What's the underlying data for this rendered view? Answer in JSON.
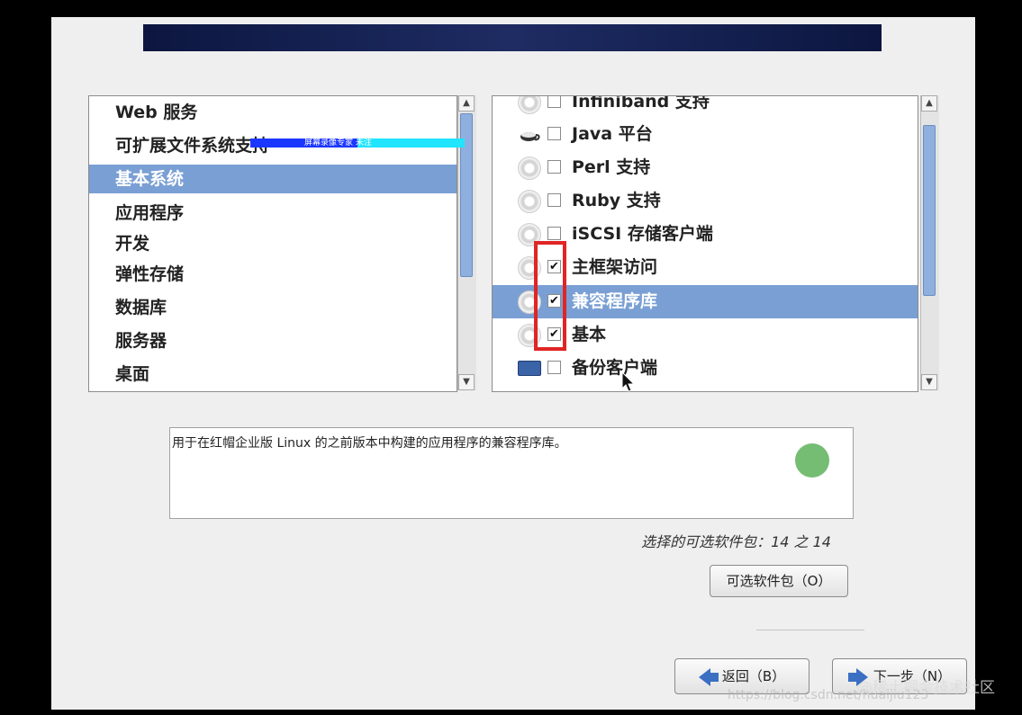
{
  "categories": [
    {
      "label": "Web 服务",
      "selected": false
    },
    {
      "label": "可扩展文件系统支持",
      "selected": false
    },
    {
      "label": "基本系统",
      "selected": true
    },
    {
      "label": "应用程序",
      "selected": false
    },
    {
      "label": "开发",
      "selected": false
    },
    {
      "label": "弹性存储",
      "selected": false
    },
    {
      "label": "数据库",
      "selected": false
    },
    {
      "label": "服务器",
      "selected": false
    },
    {
      "label": "桌面",
      "selected": false
    }
  ],
  "packages": [
    {
      "label": "Infiniband 支持",
      "checked": false,
      "icon": "gear-icon",
      "selected": false
    },
    {
      "label": "Java 平台",
      "checked": false,
      "icon": "coffee-cup-icon",
      "selected": false
    },
    {
      "label": "Perl 支持",
      "checked": false,
      "icon": "gear-icon",
      "selected": false
    },
    {
      "label": "Ruby 支持",
      "checked": false,
      "icon": "gear-icon",
      "selected": false
    },
    {
      "label": "iSCSI 存储客户端",
      "checked": false,
      "icon": "gear-icon",
      "selected": false
    },
    {
      "label": "主框架访问",
      "checked": true,
      "icon": "gear-icon",
      "selected": false
    },
    {
      "label": "兼容程序库",
      "checked": true,
      "icon": "gear-icon",
      "selected": true
    },
    {
      "label": "基本",
      "checked": true,
      "icon": "gear-icon",
      "selected": false
    },
    {
      "label": "备份客户端",
      "checked": false,
      "icon": "tape-drive-icon",
      "selected": false
    }
  ],
  "ime_bar_text": "屏幕录像专家 未注",
  "description": "用于在红帽企业版 Linux 的之前版本中构建的应用程序的兼容程序库。",
  "package_count": "选择的可选软件包：14 之 14",
  "optional_packages_button": "可选软件包（O）",
  "back_button": "返回（B）",
  "next_button": "下一步（N）",
  "watermark_url": "https://blog.csdn.net/huaijiu123",
  "watermark_site": "@稀土掘金技术社区",
  "checkmark": "✔",
  "colors": {
    "selection": "#7a9fd4",
    "banner": "#1e2c63",
    "highlight_box": "#e02525",
    "arrow": "#3b6fc2"
  }
}
